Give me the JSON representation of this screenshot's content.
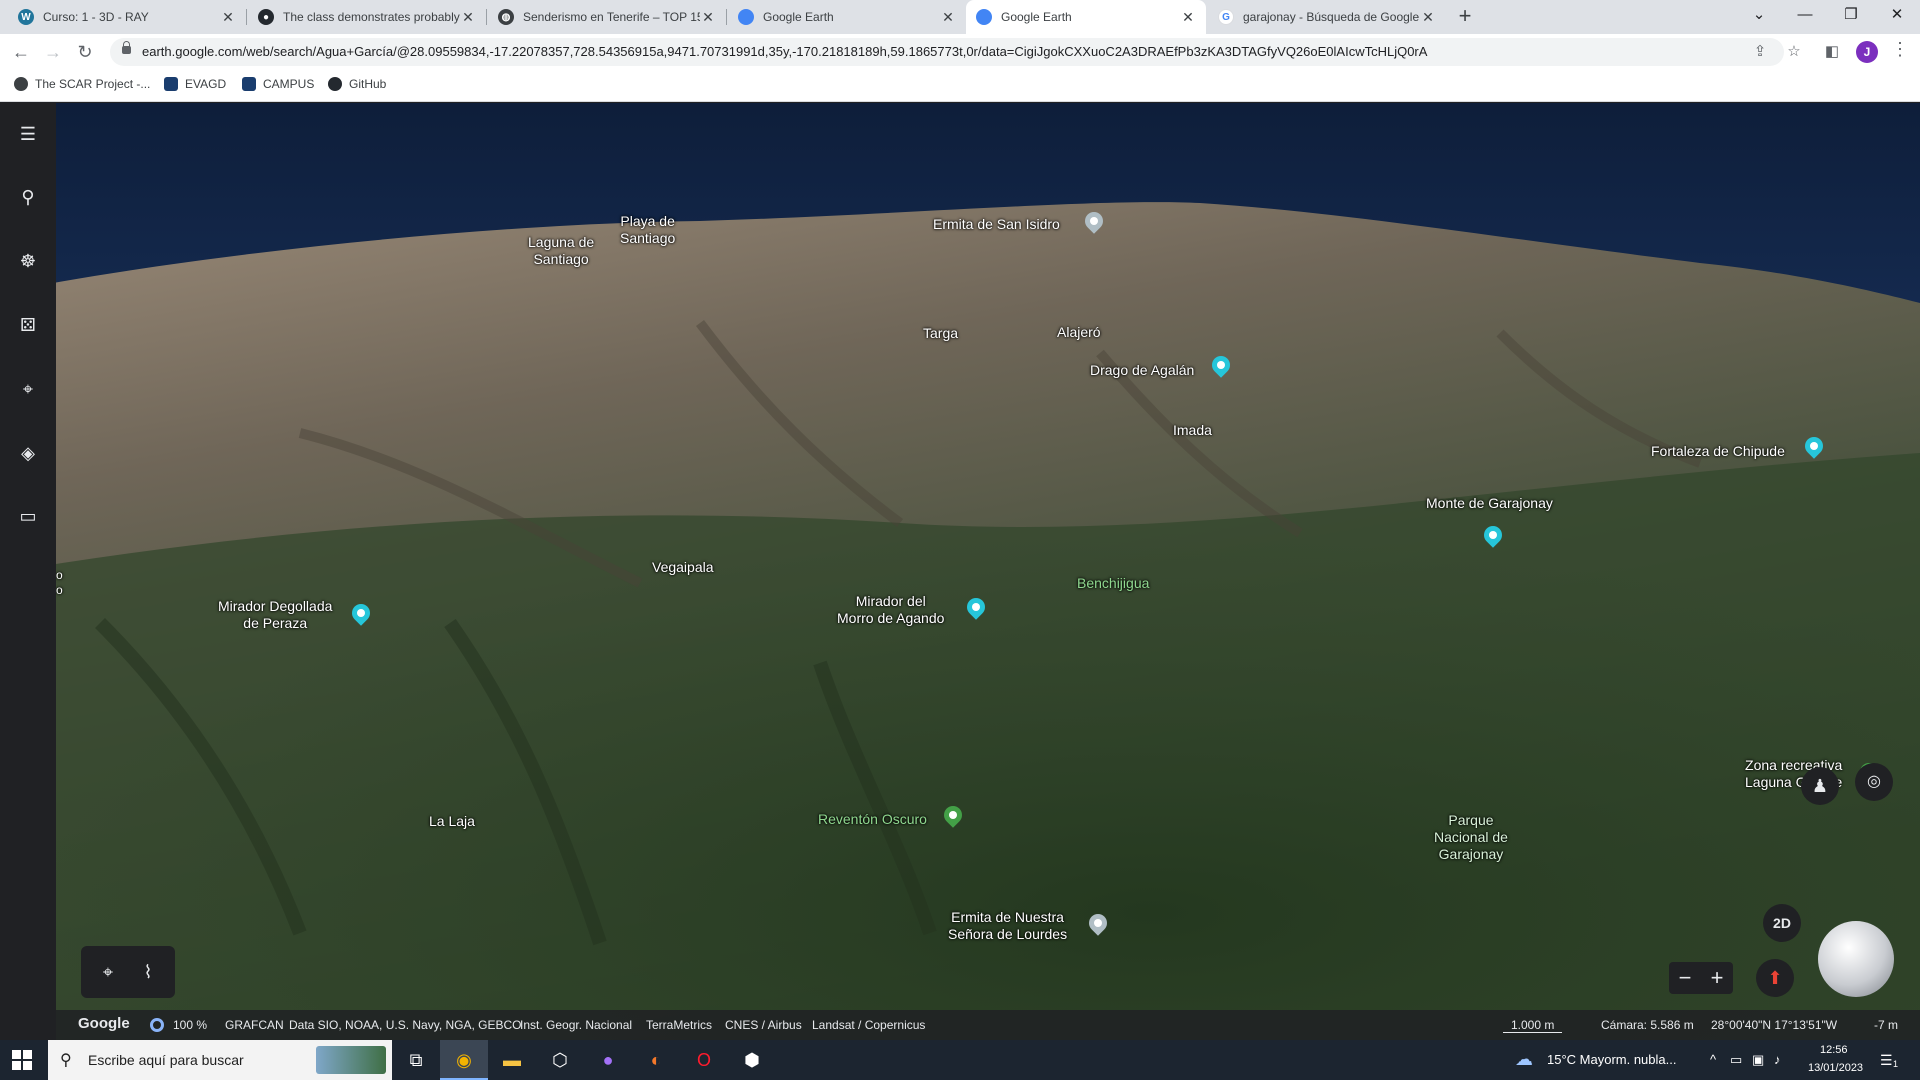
{
  "browser": {
    "tabs": [
      {
        "title": "Curso: 1 - 3D - RAY",
        "icon": "wordpress-icon",
        "color": "#21759b"
      },
      {
        "title": "The class demonstrates probably",
        "icon": "github-icon",
        "color": "#24292f"
      },
      {
        "title": "Senderismo en Tenerife – TOP 15",
        "icon": "globe-icon",
        "color": "#3c4043"
      },
      {
        "title": "Google Earth",
        "icon": "google-earth-icon",
        "color": "#4285f4"
      },
      {
        "title": "Google Earth",
        "icon": "google-earth-icon",
        "color": "#4285f4",
        "active": true
      },
      {
        "title": "garajonay - Búsqueda de Google",
        "icon": "google-icon",
        "color": "#4285f4"
      }
    ],
    "url": "earth.google.com/web/search/Agua+García/@28.09559834,-17.22078357,728.54356915a,9471.70731991d,35y,-170.21818189h,59.1865773t,0r/data=CigiJgokCXXuoC2A3DRAEfPb3zKA3DTAGfyVQ26oE0lAIcwTcHLjQ0rA",
    "avatar_letter": "J",
    "bookmarks": [
      {
        "label": "The SCAR Project -...",
        "icon": "scar-icon"
      },
      {
        "label": "EVAGD",
        "icon": "evagd-icon"
      },
      {
        "label": "CAMPUS",
        "icon": "campus-icon"
      },
      {
        "label": "GitHub",
        "icon": "github-icon"
      }
    ]
  },
  "earth": {
    "places": {
      "playa_santiago": "Playa de\nSantiago",
      "laguna_santiago": "Laguna de\nSantiago",
      "ermita_san_isidro": "Ermita de San Isidro",
      "targa": "Targa",
      "alajero": "Alajeró",
      "drago_agalan": "Drago de Agalán",
      "imada": "Imada",
      "fortaleza_chipude": "Fortaleza de Chipude",
      "monte_garajonay": "Monte de Garajonay",
      "vegaipala": "Vegaipala",
      "mirador_degollada": "Mirador Degollada\nde Peraza",
      "mirador_morro": "Mirador del\nMorro de Agando",
      "benchijigua": "Benchijigua",
      "reventon_oscuro": "Reventón Oscuro",
      "la_laja": "La Laja",
      "zona_recreativa": "Zona recreativa\nLaguna Grande",
      "parque_nacional": "Parque\nNacional de\nGarajonay",
      "ermita_lourdes": "Ermita de Nuestra\nSeñora de Lourdes",
      "edge_o": "o\no"
    },
    "view_mode": "2D",
    "attribution": {
      "brand": "Google",
      "zoom": "100 %",
      "sources": [
        "GRAFCAN",
        "Data SIO, NOAA, U.S. Navy, NGA, GEBCO",
        "Inst. Geogr. Nacional",
        "TerraMetrics",
        "CNES / Airbus",
        "Landsat / Copernicus"
      ],
      "scale": "1.000 m",
      "camera": "Cámara: 5.586 m",
      "coords": "28°00'40\"N 17°13'51\"W",
      "elevation": "-7 m"
    }
  },
  "taskbar": {
    "search_placeholder": "Escribe aquí para buscar",
    "weather": "15°C  Mayorm. nubla...",
    "time": "12:56",
    "date": "13/01/2023",
    "notifications": "1"
  }
}
